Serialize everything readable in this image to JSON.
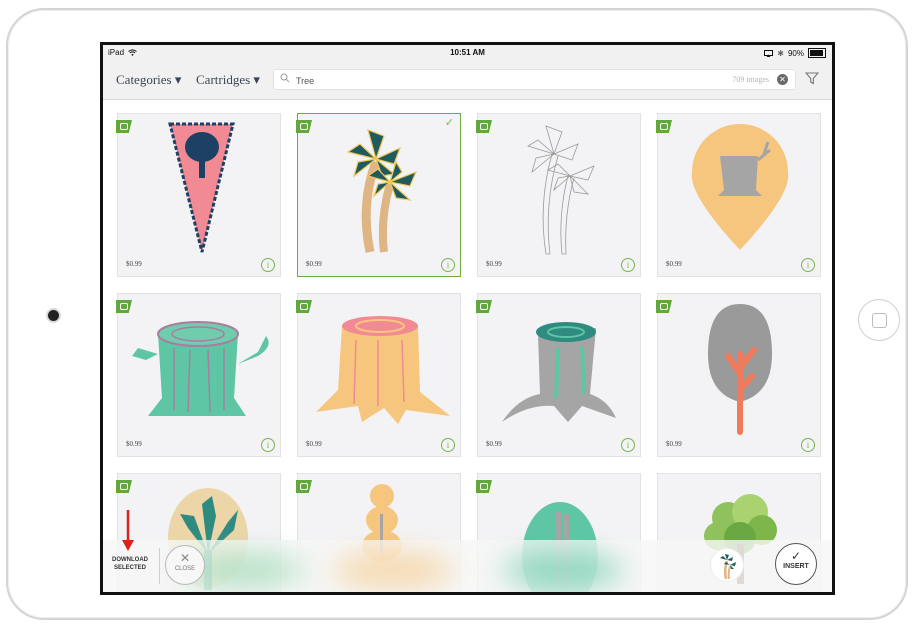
{
  "status_bar": {
    "carrier": "iPad",
    "time": "10:51 AM",
    "battery": "90%",
    "icons": [
      "wifi-icon",
      "airplay-icon",
      "bluetooth-icon",
      "battery-icon"
    ]
  },
  "toolbar": {
    "categories_label": "Categories ▾",
    "cartridges_label": "Cartridges ▾",
    "search_value": "Tree",
    "result_count": "709 images",
    "icons": [
      "search-icon",
      "clear-icon",
      "filter-icon"
    ]
  },
  "cards": [
    {
      "art": "pennant-tree",
      "price": "$0.99",
      "selected": false
    },
    {
      "art": "palm-trees-color",
      "price": "$0.99",
      "selected": true
    },
    {
      "art": "palm-trees-outline",
      "price": "$0.99",
      "selected": false
    },
    {
      "art": "stump-pin",
      "price": "$0.99",
      "selected": false
    },
    {
      "art": "teal-stump-sprout",
      "price": "$0.99",
      "selected": false
    },
    {
      "art": "peach-stump",
      "price": "$0.99",
      "selected": false
    },
    {
      "art": "grey-stump-roots",
      "price": "$0.99",
      "selected": false
    },
    {
      "art": "grey-tree-coral-trunk",
      "price": "$0.99",
      "selected": false
    },
    {
      "art": "tree-oval-beige",
      "price": "",
      "selected": false
    },
    {
      "art": "peach-topiary",
      "price": "",
      "selected": false
    },
    {
      "art": "teal-oval-tree",
      "price": "",
      "selected": false
    },
    {
      "art": "leafy-green-tree",
      "price": "",
      "selected": false
    }
  ],
  "bottom_bar": {
    "download_line1": "DOWNLOAD",
    "download_line2": "SELECTED",
    "close_label": "CLOSE",
    "insert_label": "INSERT"
  },
  "colors": {
    "accent_green": "#6dae3a",
    "annotation_red": "#e0201b",
    "navy": "#1d4165",
    "pink": "#f28a93",
    "peach": "#f6c67f",
    "teal": "#5ec6a4",
    "grey": "#9a9a9a",
    "coral": "#f07a5c"
  }
}
